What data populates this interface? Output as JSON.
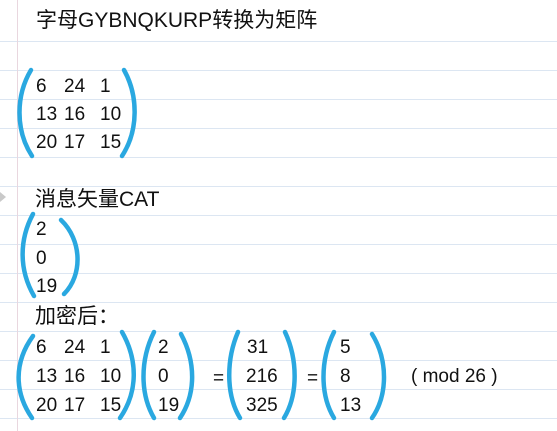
{
  "heading_key": "字母GYBNQKURP转换为矩阵",
  "key_matrix": [
    [
      "6",
      "24",
      "1"
    ],
    [
      "13",
      "16",
      "10"
    ],
    [
      "20",
      "17",
      "15"
    ]
  ],
  "heading_vector": "消息矢量CAT",
  "message_vector": [
    "2",
    "0",
    "19"
  ],
  "heading_encrypt": "加密后：",
  "encrypt": {
    "matrix": [
      [
        "6",
        "24",
        "1"
      ],
      [
        "13",
        "16",
        "10"
      ],
      [
        "20",
        "17",
        "15"
      ]
    ],
    "vector": [
      "2",
      "0",
      "19"
    ],
    "equals": "=",
    "product": [
      "31",
      "216",
      "325"
    ],
    "result": [
      "5",
      "8",
      "13"
    ],
    "modulus": "( mod  26 )"
  },
  "colors": {
    "bracket": "#2aa8e0",
    "rule_line": "#dce6f2",
    "margin_line": "#e9d7df"
  }
}
